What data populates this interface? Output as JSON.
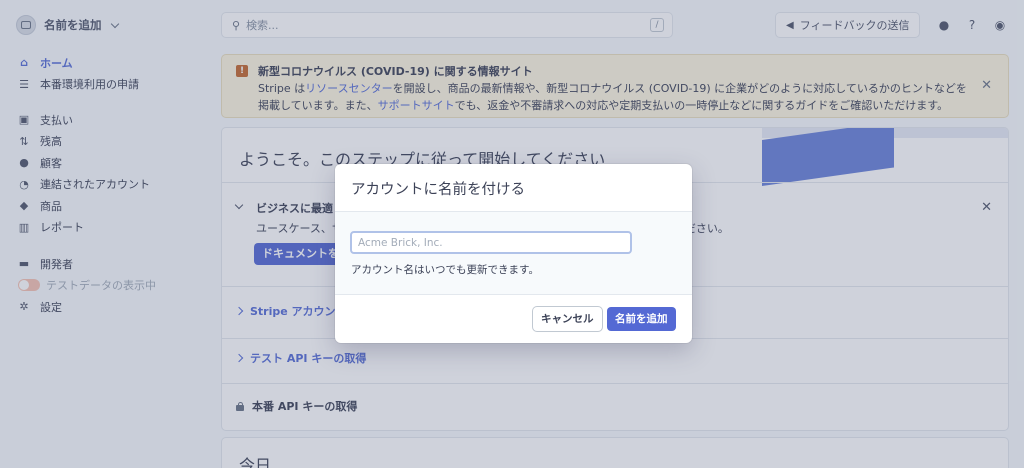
{
  "account": {
    "name": "名前を追加"
  },
  "sidebar": {
    "primary": [
      {
        "label": "ホーム",
        "icon": "home-icon",
        "glyph": "⌂",
        "active": true
      },
      {
        "label": "本番環境利用の申請",
        "icon": "activate-icon",
        "glyph": "☰"
      }
    ],
    "main": [
      {
        "label": "支払い",
        "icon": "payments-icon",
        "glyph": "▣"
      },
      {
        "label": "残高",
        "icon": "balance-icon",
        "glyph": "⇅"
      },
      {
        "label": "顧客",
        "icon": "customers-icon",
        "glyph": "●"
      },
      {
        "label": "連結されたアカウント",
        "icon": "connected-accounts-icon",
        "glyph": "◔"
      },
      {
        "label": "商品",
        "icon": "products-icon",
        "glyph": "◆"
      },
      {
        "label": "レポート",
        "icon": "reports-icon",
        "glyph": "▥"
      }
    ],
    "bottom": {
      "developers": {
        "label": "開発者",
        "glyph": "▬"
      },
      "test_data": {
        "label": "テストデータの表示中"
      },
      "settings": {
        "label": "設定",
        "glyph": "✲"
      }
    }
  },
  "topbar": {
    "search_placeholder": "検索...",
    "search_shortcut": "/",
    "feedback_label": "フィードバックの送信"
  },
  "banner": {
    "title": "新型コロナウイルス (COVID-19) に関する情報サイト",
    "line1_pre": "Stripe は",
    "line1_link": "リソースセンター",
    "line1_post": "を開設し、商品の最新情報や、新型コロナウイルス (COVID-19) に企業がどのように対応しているかのヒントなどを",
    "line2_pre": "掲載しています。また、",
    "line2_link": "サポートサイト",
    "line2_post": "でも、返金や不審請求への対応や定期支払いの一時停止などに関するガイドをご確認いただけます。"
  },
  "welcome": {
    "heading": "ようこそ。このステップに従って開始してください",
    "open_step": {
      "title": "ビジネスに最適",
      "description_left": "ユースケース、サ",
      "description_right": "ださい。",
      "button_label": "ドキュメントを"
    },
    "steps": [
      {
        "label": "Stripe アカウン",
        "locked": false
      },
      {
        "label": "テスト API キーの取得",
        "locked": false
      },
      {
        "label": "本番 API キーの取得",
        "locked": true
      }
    ]
  },
  "today": {
    "title": "今日"
  },
  "modal": {
    "title": "アカウントに名前を付ける",
    "input_placeholder": "Acme Brick, Inc.",
    "input_value": "",
    "help": "アカウント名はいつでも更新できます。",
    "cancel_label": "キャンセル",
    "submit_label": "名前を追加"
  },
  "colors": {
    "accent": "#5469d4",
    "banner_bg": "#fcf5e0",
    "warning": "#c4682f"
  }
}
